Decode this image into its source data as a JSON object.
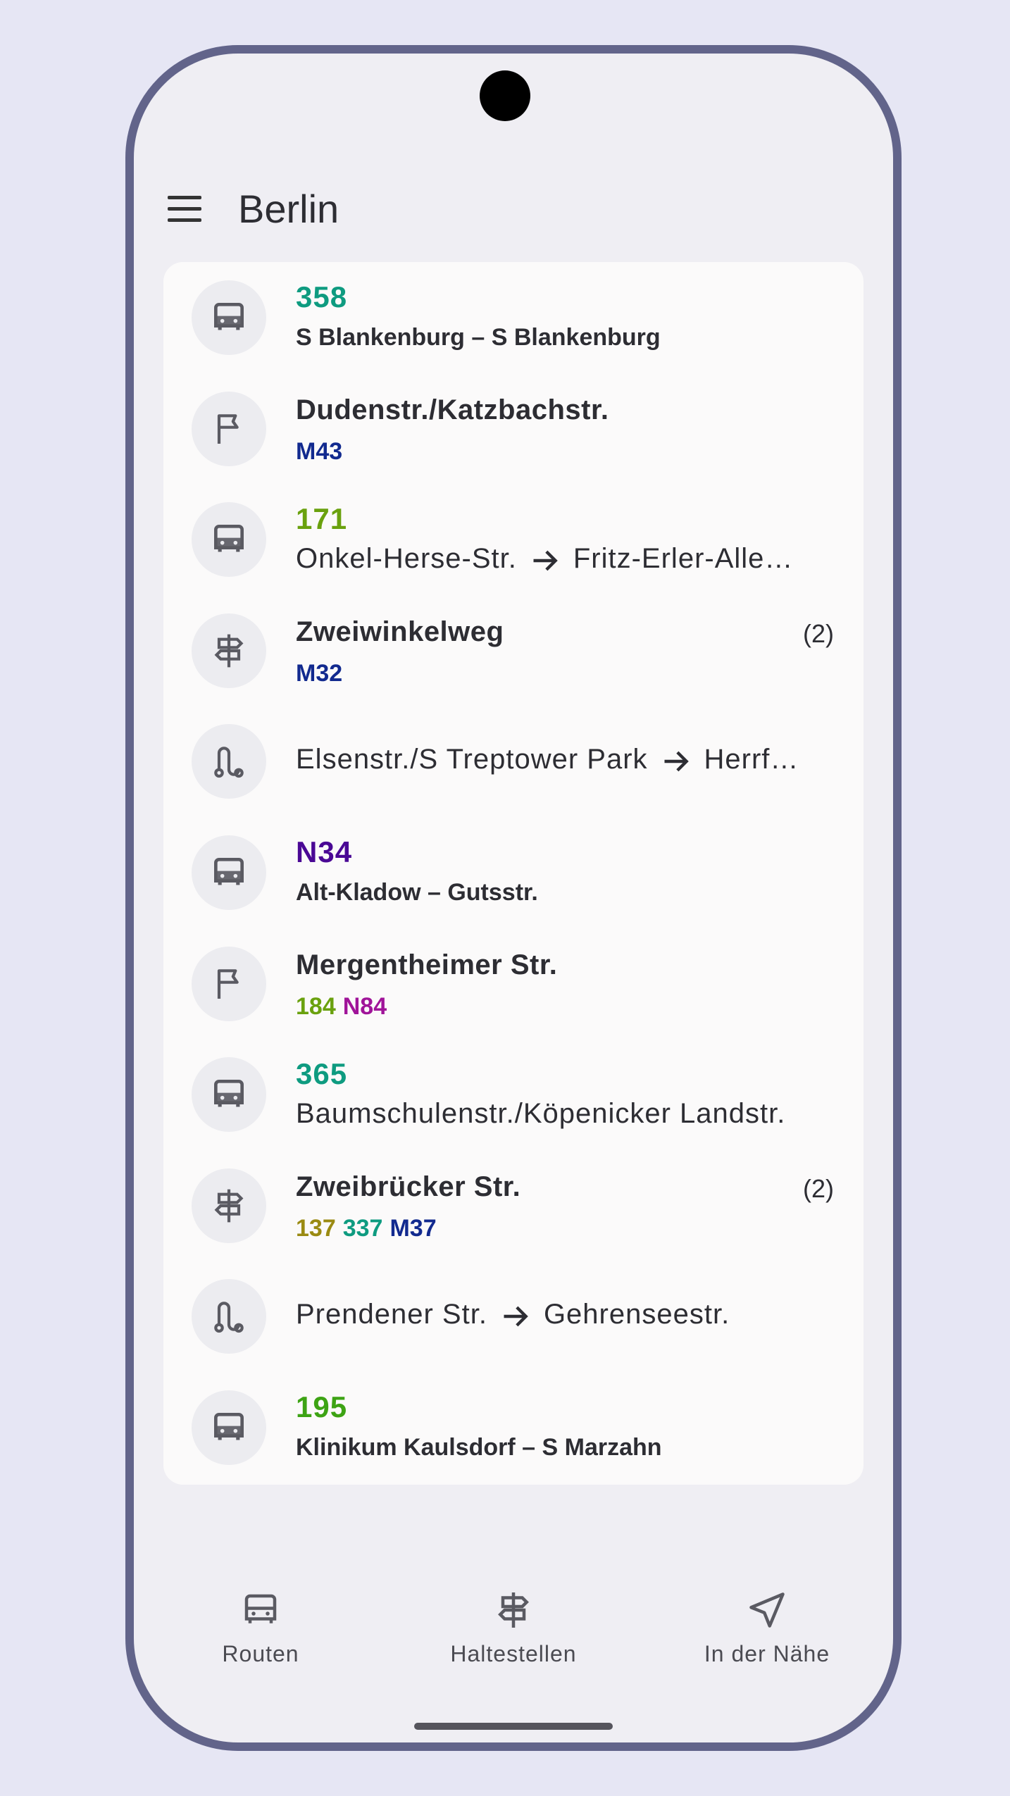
{
  "app": {
    "title": "Berlin"
  },
  "colors": {
    "teal": "#0e9b80",
    "navy": "#122a8f",
    "green": "#6aa10e",
    "purple": "#4a0895",
    "magenta": "#a01499",
    "olive": "#9a8a12",
    "green2": "#3da314",
    "text": "#2d2d33"
  },
  "list": [
    {
      "kind": "route",
      "icon": "bus-icon",
      "number": "358",
      "color": "#0e9b80",
      "subtitle": "S Blankenburg – S Blankenburg"
    },
    {
      "kind": "stop",
      "icon": "flag-icon",
      "name": "Dudenstr./Katzbachstr.",
      "lines": [
        {
          "name": "M43",
          "color": "#122a8f"
        }
      ]
    },
    {
      "kind": "route-dir",
      "icon": "bus-icon",
      "number": "171",
      "color": "#6aa10e",
      "from": "Onkel-Herse-Str.",
      "to": "Fritz-Erler-Alle…"
    },
    {
      "kind": "stop",
      "icon": "signpost-icon",
      "name": "Zweiwinkelweg",
      "count": "(2)",
      "lines": [
        {
          "name": "M32",
          "color": "#122a8f"
        }
      ]
    },
    {
      "kind": "journey",
      "icon": "path-icon",
      "from": "Elsenstr./S Treptower Park",
      "to": "Herrf…"
    },
    {
      "kind": "route",
      "icon": "bus-icon",
      "number": "N34",
      "color": "#4a0895",
      "subtitle": "Alt-Kladow – Gutsstr."
    },
    {
      "kind": "stop",
      "icon": "flag-icon",
      "name": "Mergentheimer Str.",
      "lines": [
        {
          "name": "184",
          "color": "#6aa10e"
        },
        {
          "name": "N84",
          "color": "#a01499"
        }
      ]
    },
    {
      "kind": "route-dir",
      "icon": "bus-icon",
      "number": "365",
      "color": "#0e9b80",
      "from": "Baumschulenstr./Köpenicker Landstr.",
      "to": ""
    },
    {
      "kind": "stop",
      "icon": "signpost-icon",
      "name": "Zweibrücker Str.",
      "count": "(2)",
      "lines": [
        {
          "name": "137",
          "color": "#9a8a12"
        },
        {
          "name": "337",
          "color": "#0e9b80"
        },
        {
          "name": "M37",
          "color": "#122a8f"
        }
      ]
    },
    {
      "kind": "journey",
      "icon": "path-icon",
      "from": "Prendener Str.",
      "to": "Gehrenseestr."
    },
    {
      "kind": "route",
      "icon": "bus-icon",
      "number": "195",
      "color": "#3da314",
      "subtitle": "Klinikum Kaulsdorf – S Marzahn"
    }
  ],
  "nav": {
    "routes": "Routen",
    "stops": "Haltestellen",
    "nearby": "In der Nähe"
  }
}
